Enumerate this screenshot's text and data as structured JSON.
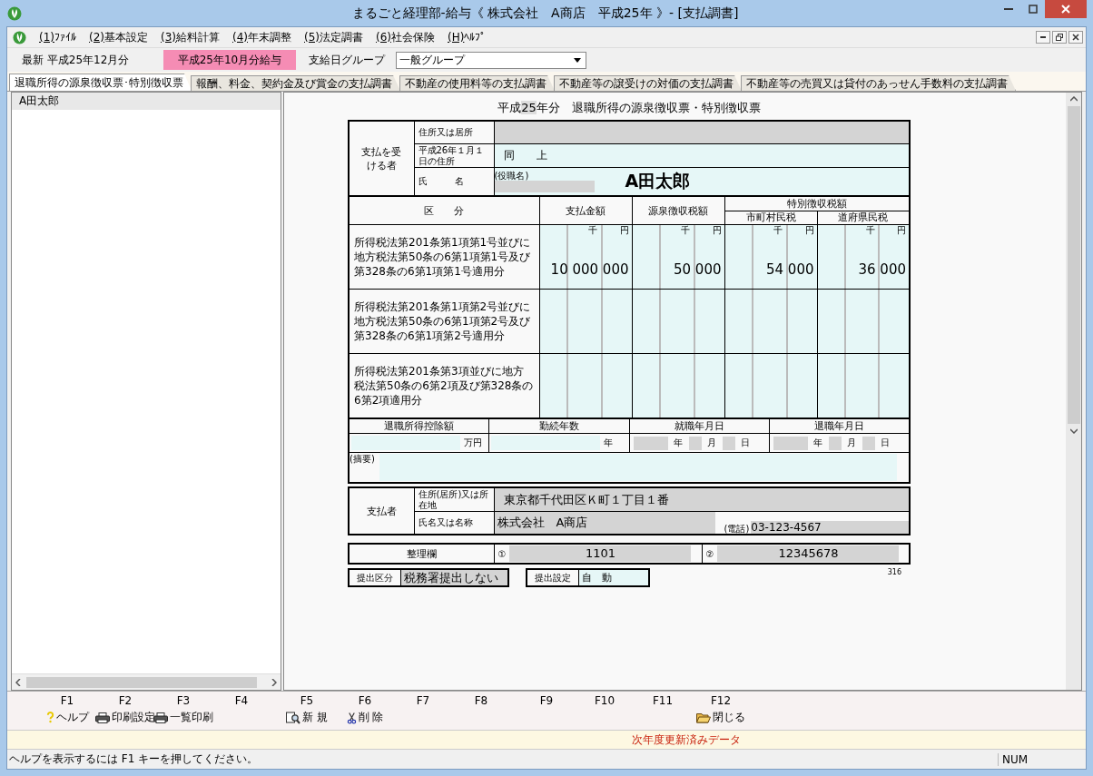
{
  "window": {
    "title": "まるごと経理部-給与《 株式会社　A商店　平成25年 》- [支払調書]"
  },
  "menu": [
    {
      "accel": "(1)",
      "label": "ﾌｧｲﾙ"
    },
    {
      "accel": "(2)",
      "label": "基本設定"
    },
    {
      "accel": "(3)",
      "label": "給料計算"
    },
    {
      "accel": "(4)",
      "label": "年末調整"
    },
    {
      "accel": "(5)",
      "label": "法定調書"
    },
    {
      "accel": "(6)",
      "label": "社会保険"
    },
    {
      "accel": "(H)",
      "label": "ﾍﾙﾌﾟ"
    }
  ],
  "toolbar": {
    "latest": "最新 平成25年12月分",
    "period": "平成25年10月分給与",
    "group_label": "支給日グループ",
    "group_value": "一般グループ"
  },
  "tabs": [
    {
      "label": "退職所得の源泉徴収票･特別徴収票",
      "selected": true
    },
    {
      "label": "報酬、料金、契約金及び賞金の支払調書",
      "selected": false
    },
    {
      "label": "不動産の使用料等の支払調書",
      "selected": false
    },
    {
      "label": "不動産等の譲受けの対価の支払調書",
      "selected": false
    },
    {
      "label": "不動産等の売買又は貸付のあっせん手数料の支払調書",
      "selected": false
    }
  ],
  "employees": [
    {
      "name": "A田太郎",
      "selected": true
    }
  ],
  "form": {
    "year_prefix": "平成",
    "year": "25",
    "title": "年分　退職所得の源泉徴収票・特別徴収票",
    "recipient": {
      "label": "支払を受ける者",
      "address_label": "住所又は居所",
      "jan1_label": "平成26年１月１日の住所",
      "jan1_value": "同　　上",
      "name_label": "氏　　　名",
      "role_label": "(役職名)",
      "name": "A田太郎"
    },
    "headers": {
      "section": "区　　分",
      "paid": "支払金額",
      "withheld": "源泉徴収税額",
      "special": "特別徴収税額",
      "municipal": "市町村民税",
      "prefectural": "道府県民税"
    },
    "units": [
      {
        "thousand": "千",
        "yen": "円"
      },
      {
        "thousand": "千",
        "yen": "円"
      },
      {
        "thousand": "千",
        "yen": "円"
      },
      {
        "thousand": "千",
        "yen": "円"
      }
    ],
    "rows": [
      {
        "label": "所得税法第201条第1項第1号並びに地方税法第50条の6第1項第1号及び第328条の6第1項第1号適用分",
        "values": [
          "10 000 000",
          "50 000",
          "54 000",
          "36 000"
        ]
      },
      {
        "label": "所得税法第201条第1項第2号並びに地方税法第50条の6第1項第2号及び第328条の6第1項第2号適用分"
      },
      {
        "label": "所得税法第201条第3項並びに地方税法第50条の6第2項及び第328条の6第2項適用分"
      }
    ],
    "service": {
      "deduction_label": "退職所得控除額",
      "years_label": "勤続年数",
      "hire_label": "就職年月日",
      "retire_label": "退職年月日",
      "deduction_unit": "万円",
      "years_unit": "年",
      "hire_units": [
        "年",
        "月",
        "日"
      ],
      "retire_units": [
        "年",
        "月",
        "日"
      ],
      "remarks_label": "(摘要)"
    },
    "payer": {
      "label": "支払者",
      "address_label": "住所(居所)又は所在地",
      "address": "東京都千代田区Ｋ町１丁目１番",
      "name_label": "氏名又は名称",
      "name": "株式会社　A商店",
      "phone_label": "(電話)",
      "phone": "03-123-4567"
    },
    "reference": {
      "label": "整理欄",
      "items": [
        {
          "mark": "①",
          "value": "1101"
        },
        {
          "mark": "②",
          "value": "12345678"
        }
      ]
    },
    "submission": {
      "category_label": "提出区分",
      "category": "税務署提出しない",
      "setting_label": "提出設定",
      "setting": "自　動"
    },
    "code": "316"
  },
  "function_keys": [
    {
      "key": "F1",
      "kind": "help",
      "label": "ヘルプ"
    },
    {
      "key": "F2",
      "kind": "print",
      "label": "印刷設定"
    },
    {
      "key": "F3",
      "kind": "print",
      "label": "一覧印刷"
    },
    {
      "key": "F4",
      "kind": "none"
    },
    {
      "key": "F5",
      "kind": "new",
      "label": "新 規"
    },
    {
      "key": "F6",
      "kind": "delete",
      "label": "削 除"
    },
    {
      "key": "F7",
      "kind": "none"
    },
    {
      "key": "F8",
      "kind": "none"
    },
    {
      "key": "F9",
      "kind": "none"
    },
    {
      "key": "F10",
      "kind": "none"
    },
    {
      "key": "F11",
      "kind": "none"
    },
    {
      "key": "F12",
      "kind": "close",
      "label": "閉じる"
    }
  ],
  "notice": "次年度更新済みデータ",
  "status_bar": {
    "text": "ヘルプを表示するには F1 キーを押してください。",
    "indicator": "NUM"
  }
}
